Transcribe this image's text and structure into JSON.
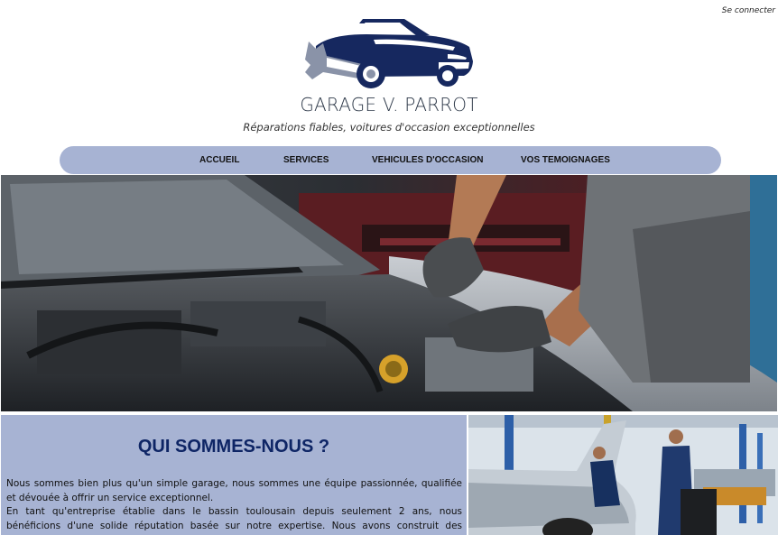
{
  "header": {
    "login_link": "Se connecter",
    "brand_name": "GARAGE V. PARROT",
    "tagline": "Réparations fiables, voitures d'occasion exceptionnelles",
    "logo_icon": "car-wrench-logo-icon"
  },
  "nav": {
    "items": [
      {
        "label": "ACCUEIL"
      },
      {
        "label": "SERVICES"
      },
      {
        "label": "VEHICULES D'OCCASION"
      },
      {
        "label": "VOS TEMOIGNAGES"
      }
    ]
  },
  "hero": {
    "image": "mechanic-working-on-engine-photo"
  },
  "about": {
    "title": "QUI SOMMES-NOUS ?",
    "paragraph1": "Nous sommes bien plus qu'un simple garage, nous sommes une équipe passionnée, qualifiée et dévouée à offrir un service exceptionnel.",
    "paragraph2": "En tant qu'entreprise établie dans le bassin toulousain depuis seulement 2 ans, nous bénéficions d'une solide réputation basée sur notre expertise. Nous avons construit des relations durables avec nos clients",
    "image": "mechanics-in-workshop-photo"
  },
  "colors": {
    "nav_bg": "#a7b3d3",
    "brand_navy": "#0e2565",
    "logo_navy": "#16285f"
  }
}
